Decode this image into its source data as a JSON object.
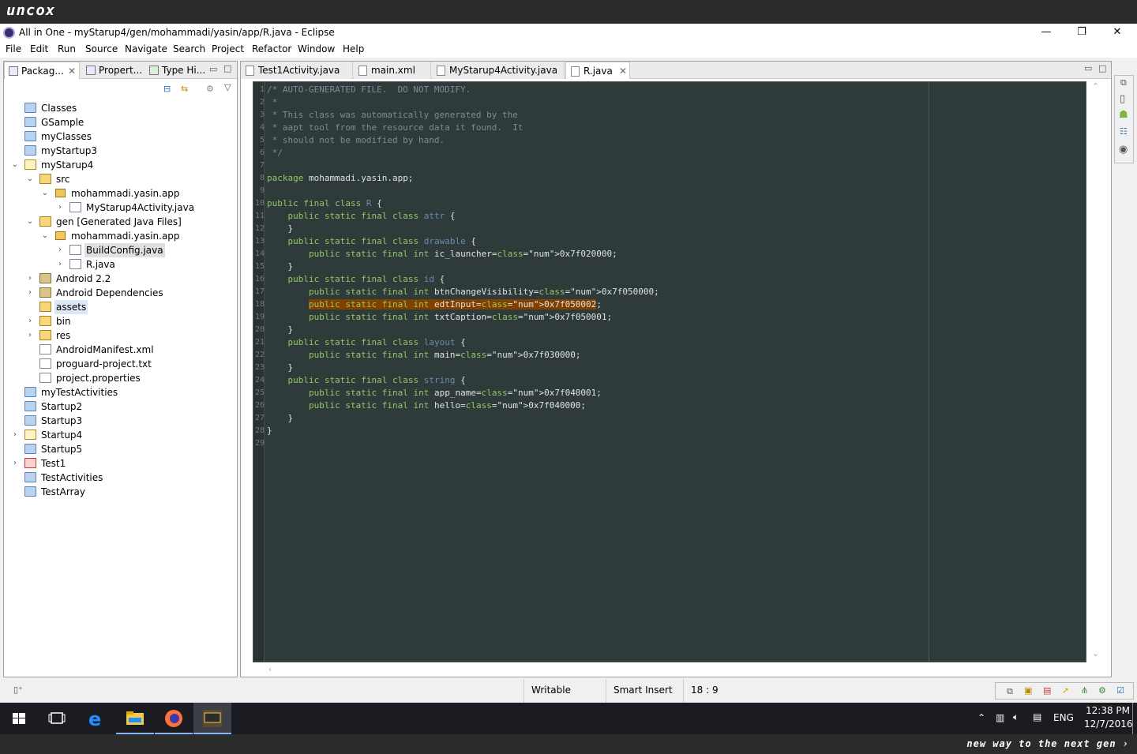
{
  "brand": {
    "logo": "uncox",
    "slogan": "new way to the next gen ›"
  },
  "window": {
    "title": "All in One - myStarup4/gen/mohammadi/yasin/app/R.java - Eclipse",
    "minimize": "—",
    "maximize": "❐",
    "close": "✕"
  },
  "menu": [
    "File",
    "Edit",
    "Run",
    "Source",
    "Navigate",
    "Search",
    "Project",
    "Refactor",
    "Window",
    "Help"
  ],
  "left_tabs": [
    {
      "label": "Packag..."
    },
    {
      "label": "Propert..."
    },
    {
      "label": "Type Hi..."
    }
  ],
  "tree": [
    {
      "label": "Classes",
      "icon": "folder-icon"
    },
    {
      "label": "GSample",
      "icon": "folder-icon"
    },
    {
      "label": "myClasses",
      "icon": "folder-icon"
    },
    {
      "label": "myStartup3",
      "icon": "folder-icon"
    },
    {
      "label": "myStarup4",
      "icon": "project-icon",
      "expanded": true
    },
    {
      "label": "src",
      "icon": "source-folder-icon",
      "expanded": true
    },
    {
      "label": "mohammadi.yasin.app",
      "icon": "package-icon",
      "expanded": true
    },
    {
      "label": "MyStarup4Activity.java",
      "icon": "java-file-icon"
    },
    {
      "label": "gen [Generated Java Files]",
      "icon": "source-folder-icon",
      "expanded": true
    },
    {
      "label": "mohammadi.yasin.app",
      "icon": "package-icon",
      "expanded": true
    },
    {
      "label": "BuildConfig.java",
      "icon": "java-file-icon",
      "selected": true
    },
    {
      "label": "R.java",
      "icon": "java-file-icon"
    },
    {
      "label": "Android 2.2",
      "icon": "library-icon"
    },
    {
      "label": "Android Dependencies",
      "icon": "library-icon"
    },
    {
      "label": "assets",
      "icon": "folder-icon",
      "highlighted": true
    },
    {
      "label": "bin",
      "icon": "folder-icon"
    },
    {
      "label": "res",
      "icon": "folder-icon"
    },
    {
      "label": "AndroidManifest.xml",
      "icon": "xml-file-icon"
    },
    {
      "label": "proguard-project.txt",
      "icon": "text-file-icon"
    },
    {
      "label": "project.properties",
      "icon": "text-file-icon"
    },
    {
      "label": "myTestActivities",
      "icon": "folder-icon"
    },
    {
      "label": "Startup2",
      "icon": "folder-icon"
    },
    {
      "label": "Startup3",
      "icon": "folder-icon"
    },
    {
      "label": "Startup4",
      "icon": "project-icon"
    },
    {
      "label": "Startup5",
      "icon": "folder-icon"
    },
    {
      "label": "Test1",
      "icon": "error-project-icon"
    },
    {
      "label": "TestActivities",
      "icon": "folder-icon"
    },
    {
      "label": "TestArray",
      "icon": "folder-icon"
    }
  ],
  "editor_tabs": [
    {
      "label": "Test1Activity.java"
    },
    {
      "label": "main.xml"
    },
    {
      "label": "MyStarup4Activity.java"
    },
    {
      "label": "R.java",
      "active": true
    }
  ],
  "code": [
    {
      "n": "1",
      "text": "/* AUTO-GENERATED FILE.  DO NOT MODIFY."
    },
    {
      "n": "2",
      "text": " *"
    },
    {
      "n": "3",
      "text": " * This class was automatically generated by the"
    },
    {
      "n": "4",
      "text": " * aapt tool from the resource data it found.  It"
    },
    {
      "n": "5",
      "text": " * should not be modified by hand."
    },
    {
      "n": "6",
      "text": " */"
    },
    {
      "n": "7",
      "text": ""
    },
    {
      "n": "8",
      "text": "package mohammadi.yasin.app;"
    },
    {
      "n": "9",
      "text": ""
    },
    {
      "n": "10",
      "text": "public final class R {"
    },
    {
      "n": "11",
      "text": "    public static final class attr {"
    },
    {
      "n": "12",
      "text": "    }"
    },
    {
      "n": "13",
      "text": "    public static final class drawable {"
    },
    {
      "n": "14",
      "text": "        public static final int ic_launcher=0x7f020000;"
    },
    {
      "n": "15",
      "text": "    }"
    },
    {
      "n": "16",
      "text": "    public static final class id {"
    },
    {
      "n": "17",
      "text": "        public static final int btnChangeVisibility=0x7f050000;"
    },
    {
      "n": "18",
      "text": "        public static final int edtInput=0x7f050002;"
    },
    {
      "n": "19",
      "text": "        public static final int txtCaption=0x7f050001;"
    },
    {
      "n": "20",
      "text": "    }"
    },
    {
      "n": "21",
      "text": "    public static final class layout {"
    },
    {
      "n": "22",
      "text": "        public static final int main=0x7f030000;"
    },
    {
      "n": "23",
      "text": "    }"
    },
    {
      "n": "24",
      "text": "    public static final class string {"
    },
    {
      "n": "25",
      "text": "        public static final int app_name=0x7f040001;"
    },
    {
      "n": "26",
      "text": "        public static final int hello=0x7f040000;"
    },
    {
      "n": "27",
      "text": "    }"
    },
    {
      "n": "28",
      "text": "}"
    },
    {
      "n": "29",
      "text": ""
    }
  ],
  "status": {
    "writable": "Writable",
    "insert_mode": "Smart Insert",
    "position": "18 : 9"
  },
  "taskbar": {
    "time": "12:38 PM",
    "date": "12/7/2016",
    "lang": "ENG"
  },
  "colors": {
    "editor_bg": "#2f3a3b",
    "keyword": "#93c763",
    "class_name": "#678cb1",
    "number": "#ffcd22",
    "comment": "#7d8c93",
    "highlight": "#804000"
  }
}
